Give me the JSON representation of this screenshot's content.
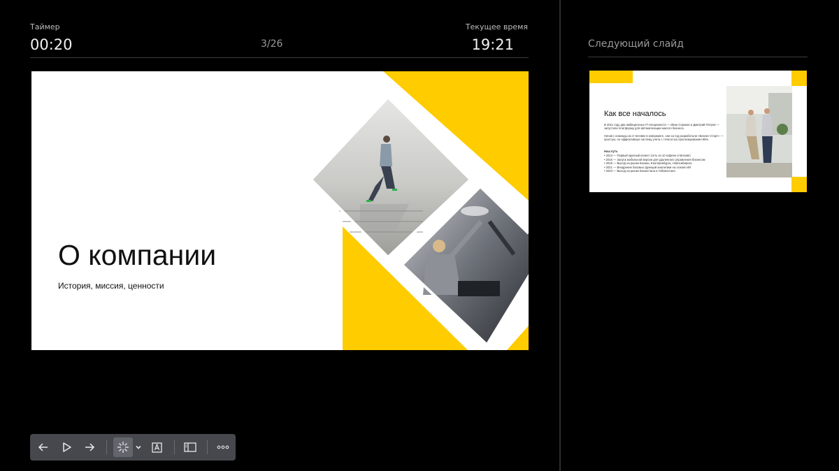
{
  "header": {
    "timer_label": "Таймер",
    "timer_value": "00:20",
    "slide_counter": "3/26",
    "clock_label": "Текущее время",
    "clock_value": "19:21"
  },
  "current_slide": {
    "title": "О компании",
    "subtitle": "История, миссия, ценности"
  },
  "next_slide": {
    "heading": "Следующий слайд",
    "title": "Как все началось",
    "para1": "В 2011 году два амбициозных IT-специалиста — Иван Сорокин и Дмитрий Петров — запустили платформу для автоматизации малого бизнеса.",
    "para2": "Начав с команды из 3 человек в коворкинге, они за год разработали «Бизнес-Старт» — простую, но эффективную систему учета с точностью прогнозирования 95%.",
    "path_title": "Наш путь",
    "milestones": [
      "2013 — Первый крупный клиент (сеть из 10 кофеен в Москве)",
      "2015 — Запуск мобильной версии для удаленного управления бизнесом",
      "2019 — Выход на рынки Казани, Екатеринбурга, Новосибирска",
      "2021 — Внедрение базовых функций аналитики на основе ИИ",
      "2023 — Выход на рынки Казахстана и Узбекистана"
    ]
  },
  "toolbar": {
    "buttons": [
      "arrow-left-icon",
      "play-icon",
      "arrow-right-icon",
      "laser-pointer-icon",
      "chevron-down-icon",
      "text-icon",
      "sidebar-icon",
      "more-icon"
    ]
  },
  "colors": {
    "background": "#000000",
    "accent_yellow": "#FFCC00",
    "toolbar_bg": "#46484D"
  }
}
